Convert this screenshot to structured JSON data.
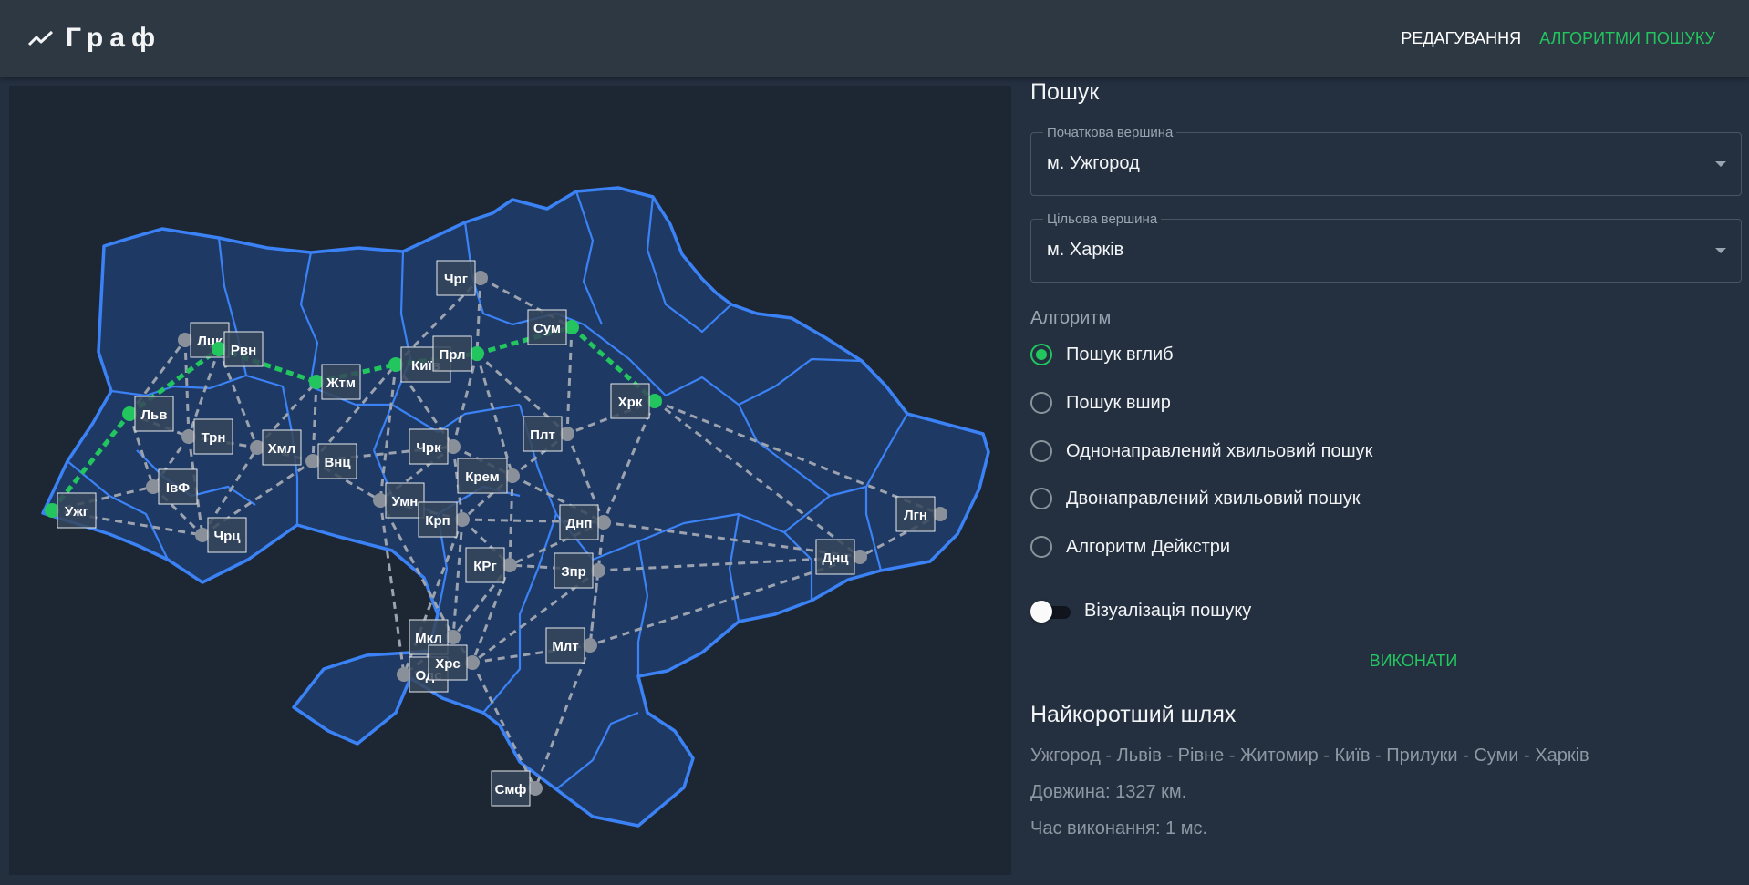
{
  "app": {
    "title": "Граф",
    "logo_icon": "trending-up-icon"
  },
  "nav": [
    {
      "label": "РЕДАГУВАННЯ",
      "active": false
    },
    {
      "label": "АЛГОРИТМИ ПОШУКУ",
      "active": true
    }
  ],
  "colors": {
    "accent": "#22c55e",
    "region_fill": "#1e3a64",
    "region_border": "#3b82f6",
    "edge": "#9ca3af"
  },
  "search": {
    "title": "Пошук",
    "start": {
      "label": "Початкова вершина",
      "value": "м. Ужгород"
    },
    "target": {
      "label": "Цільова вершина",
      "value": "м. Харків"
    },
    "algorithm_label": "Алгоритм",
    "algorithms": [
      {
        "label": "Пошук вглиб",
        "selected": true
      },
      {
        "label": "Пошук вшир",
        "selected": false
      },
      {
        "label": "Однонаправлений хвильовий пошук",
        "selected": false
      },
      {
        "label": "Двонаправлений хвильовий пошук",
        "selected": false
      },
      {
        "label": "Алгоритм Дейкстри",
        "selected": false
      }
    ],
    "visualization_label": "Візуалізація пошуку",
    "visualization_on": false,
    "run_label": "ВИКОНАТИ"
  },
  "result": {
    "title": "Найкоротший шлях",
    "path": "Ужгород - Львів - Рівне - Житомир - Київ - Прилуки - Суми - Харків",
    "length": "Довжина: 1327 км.",
    "time": "Час виконання: 1 мс."
  },
  "graph": {
    "nodes": [
      {
        "id": "uzh",
        "label": "Ужг"
      },
      {
        "id": "lviv",
        "label": "Льв"
      },
      {
        "id": "lutsk",
        "label": "Лцк"
      },
      {
        "id": "rivne",
        "label": "Рвн"
      },
      {
        "id": "tern",
        "label": "Трн"
      },
      {
        "id": "ivf",
        "label": "ІвФ"
      },
      {
        "id": "chern",
        "label": "Чрц"
      },
      {
        "id": "khm",
        "label": "Хмл"
      },
      {
        "id": "zhyt",
        "label": "Жтм"
      },
      {
        "id": "vinn",
        "label": "Внц"
      },
      {
        "id": "kyiv",
        "label": "Київ"
      },
      {
        "id": "chrg",
        "label": "Чрг"
      },
      {
        "id": "prl",
        "label": "Прл"
      },
      {
        "id": "sumy",
        "label": "Сум"
      },
      {
        "id": "khar",
        "label": "Хрк"
      },
      {
        "id": "plt",
        "label": "Плт"
      },
      {
        "id": "chrk",
        "label": "Чрк"
      },
      {
        "id": "krem",
        "label": "Крем"
      },
      {
        "id": "uman",
        "label": "Умн"
      },
      {
        "id": "krp",
        "label": "Крп"
      },
      {
        "id": "dnp",
        "label": "Днп"
      },
      {
        "id": "lgn",
        "label": "Лгн"
      },
      {
        "id": "dnts",
        "label": "Днц"
      },
      {
        "id": "zpr",
        "label": "Зпр"
      },
      {
        "id": "krg",
        "label": "КРг"
      },
      {
        "id": "mkl",
        "label": "Мкл"
      },
      {
        "id": "ods",
        "label": "Одс"
      },
      {
        "id": "hrs",
        "label": "Хрс"
      },
      {
        "id": "mlt",
        "label": "Млт"
      },
      {
        "id": "smf",
        "label": "Смф"
      }
    ],
    "edges": [
      [
        "uzh",
        "lviv"
      ],
      [
        "uzh",
        "ivf"
      ],
      [
        "uzh",
        "chern"
      ],
      [
        "lviv",
        "lutsk"
      ],
      [
        "lviv",
        "rivne"
      ],
      [
        "lviv",
        "tern"
      ],
      [
        "lviv",
        "ivf"
      ],
      [
        "lutsk",
        "rivne"
      ],
      [
        "lutsk",
        "tern"
      ],
      [
        "rivne",
        "tern"
      ],
      [
        "rivne",
        "khm"
      ],
      [
        "rivne",
        "zhyt"
      ],
      [
        "tern",
        "ivf"
      ],
      [
        "tern",
        "khm"
      ],
      [
        "tern",
        "chern"
      ],
      [
        "ivf",
        "chern"
      ],
      [
        "chern",
        "khm"
      ],
      [
        "chern",
        "vinn"
      ],
      [
        "khm",
        "zhyt"
      ],
      [
        "khm",
        "vinn"
      ],
      [
        "zhyt",
        "vinn"
      ],
      [
        "zhyt",
        "kyiv"
      ],
      [
        "vinn",
        "kyiv"
      ],
      [
        "vinn",
        "uman"
      ],
      [
        "vinn",
        "chrk"
      ],
      [
        "kyiv",
        "chrg"
      ],
      [
        "kyiv",
        "prl"
      ],
      [
        "kyiv",
        "chrk"
      ],
      [
        "kyiv",
        "uman"
      ],
      [
        "chrg",
        "prl"
      ],
      [
        "chrg",
        "sumy"
      ],
      [
        "prl",
        "sumy"
      ],
      [
        "prl",
        "plt"
      ],
      [
        "prl",
        "chrk"
      ],
      [
        "prl",
        "krem"
      ],
      [
        "sumy",
        "khar"
      ],
      [
        "sumy",
        "plt"
      ],
      [
        "khar",
        "plt"
      ],
      [
        "khar",
        "dnp"
      ],
      [
        "khar",
        "lgn"
      ],
      [
        "khar",
        "dnts"
      ],
      [
        "plt",
        "krem"
      ],
      [
        "plt",
        "dnp"
      ],
      [
        "chrk",
        "uman"
      ],
      [
        "chrk",
        "krem"
      ],
      [
        "chrk",
        "krp"
      ],
      [
        "krem",
        "krp"
      ],
      [
        "krem",
        "dnp"
      ],
      [
        "krem",
        "krg"
      ],
      [
        "uman",
        "krp"
      ],
      [
        "uman",
        "mkl"
      ],
      [
        "uman",
        "ods"
      ],
      [
        "krp",
        "dnp"
      ],
      [
        "krp",
        "krg"
      ],
      [
        "krp",
        "mkl"
      ],
      [
        "krp",
        "ods"
      ],
      [
        "dnp",
        "zpr"
      ],
      [
        "dnp",
        "dnts"
      ],
      [
        "dnp",
        "krg"
      ],
      [
        "dnp",
        "mlt"
      ],
      [
        "lgn",
        "dnts"
      ],
      [
        "dnts",
        "zpr"
      ],
      [
        "dnts",
        "mlt"
      ],
      [
        "zpr",
        "krg"
      ],
      [
        "zpr",
        "mlt"
      ],
      [
        "zpr",
        "hrs"
      ],
      [
        "krg",
        "mkl"
      ],
      [
        "krg",
        "hrs"
      ],
      [
        "mkl",
        "ods"
      ],
      [
        "mkl",
        "hrs"
      ],
      [
        "hrs",
        "mlt"
      ],
      [
        "hrs",
        "smf"
      ],
      [
        "hrs",
        "ods"
      ],
      [
        "mlt",
        "smf"
      ],
      [
        "ods",
        "hrs"
      ]
    ],
    "path": [
      "uzh",
      "lviv",
      "rivne",
      "zhyt",
      "kyiv",
      "prl",
      "sumy",
      "khar"
    ]
  }
}
